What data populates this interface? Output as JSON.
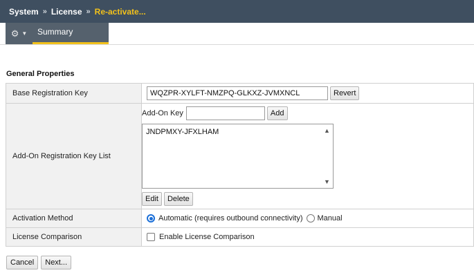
{
  "breadcrumb": {
    "items": [
      "System",
      "License",
      "Re-activate..."
    ],
    "separator": "»"
  },
  "tabs": {
    "gear_icon": "gear-icon",
    "summary_label": "Summary"
  },
  "section": {
    "title": "General Properties"
  },
  "properties": {
    "base_key_label": "Base Registration Key",
    "base_key_value": "WQZPR-XYLFT-NMZPQ-GLKXZ-JVMXNCL",
    "revert_label": "Revert",
    "addon_list_label": "Add-On Registration Key List",
    "addon_key_label": "Add-On Key",
    "addon_key_value": "",
    "add_label": "Add",
    "addon_keys": [
      "JNDPMXY-JFXLHAM"
    ],
    "edit_label": "Edit",
    "delete_label": "Delete",
    "activation_label": "Activation Method",
    "activation_automatic": "Automatic (requires outbound connectivity)",
    "activation_manual": "Manual",
    "activation_selected": "Automatic",
    "comparison_label": "License Comparison",
    "comparison_checkbox_label": "Enable License Comparison",
    "comparison_checked": false
  },
  "footer": {
    "cancel_label": "Cancel",
    "next_label": "Next..."
  },
  "colors": {
    "header_bg": "#3f4f60",
    "breadcrumb_current": "#f2c11b",
    "tab_bg": "#55616d",
    "tab_underline": "#f2c11b",
    "radio_selected": "#1b6fd8"
  }
}
